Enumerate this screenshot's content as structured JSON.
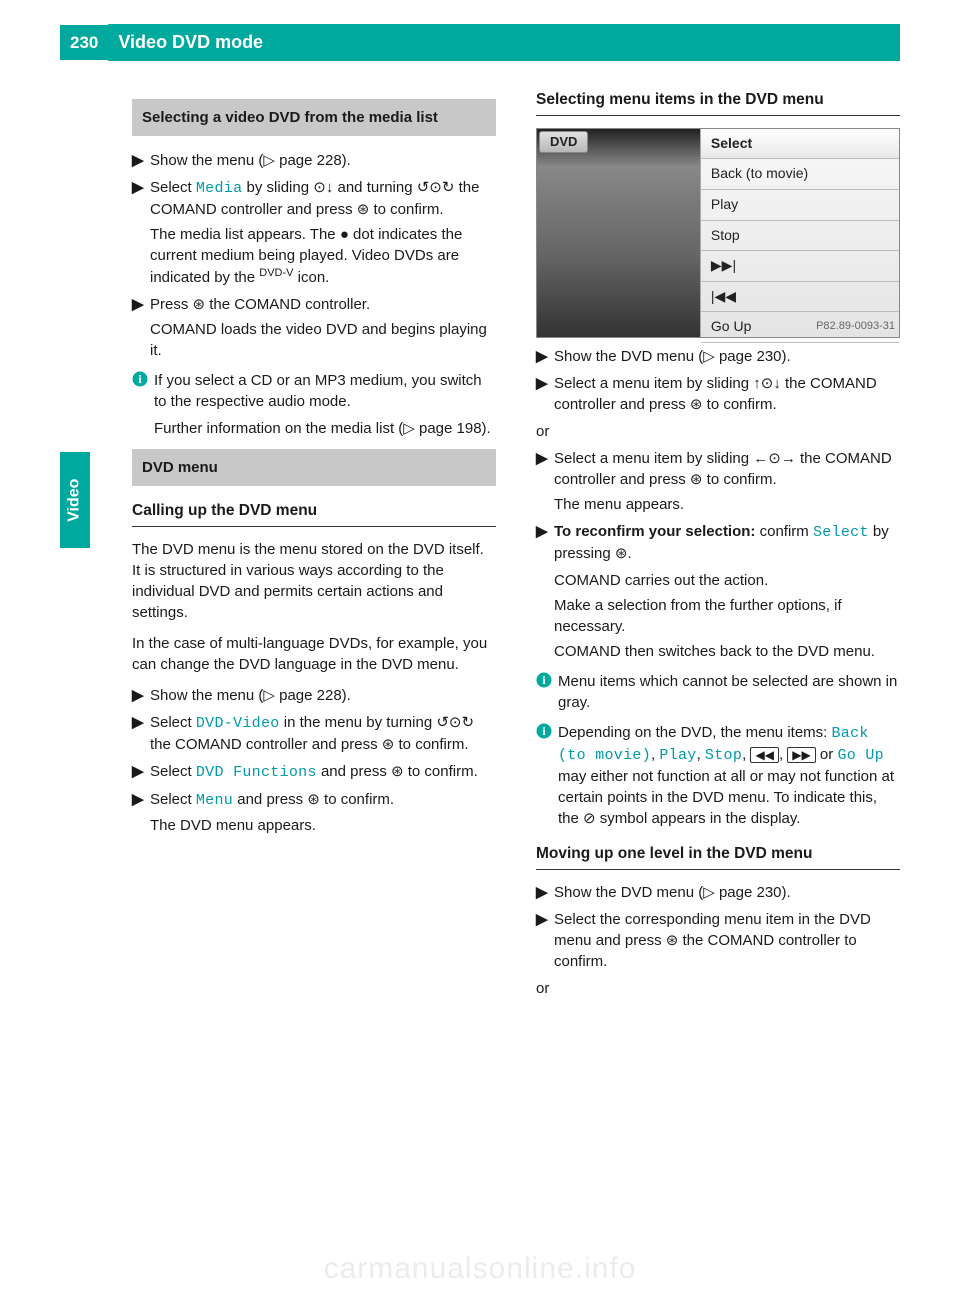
{
  "page_number": "230",
  "page_title": "Video DVD mode",
  "side_tab": "Video",
  "watermark": "carmanualsonline.info",
  "glyphs": {
    "step": "▶",
    "page_ref": "▷",
    "dot": "●",
    "press": "⊛",
    "info_title": "i",
    "slide_vert": "⊙↓",
    "turn": "↺⊙↻",
    "slide_ud": "↑⊙↓",
    "slide_lr": "←⊙→",
    "prohibit": "⊘",
    "dvd_icon": "ⓓ",
    "rewind": "◀◀",
    "ffwd": "▶▶"
  },
  "left": {
    "gray1": "Selecting a video DVD from the media list",
    "s1": {
      "pre": "Show the menu (",
      "suf": " page 228)."
    },
    "s2": {
      "pre": "Select ",
      "media": "Media",
      "mid1": " by sliding ",
      "mid2": " and turning ",
      "mid3": " the COMAND controller and press ",
      "suf": " to confirm."
    },
    "s2_cont": {
      "pre": "The media list appears. The ",
      "mid": " dot indicates the current medium being played. Video DVDs are indicated by the ",
      "suf": " icon."
    },
    "s3": {
      "pre": "Press ",
      "mid": " the COMAND controller.",
      "cont": "COMAND loads the video DVD and begins playing it."
    },
    "info1": {
      "l1": "If you select a CD or an MP3 medium, you switch to the respective audio mode.",
      "l2_pre": "Further information on the media list (",
      "l2_suf": " page 198)."
    },
    "gray2": "DVD menu",
    "sub1": "Calling up the DVD menu",
    "p1": "The DVD menu is the menu stored on the DVD itself. It is structured in various ways according to the individual DVD and permits certain actions and settings.",
    "p2": "In the case of multi-language DVDs, for example, you can change the DVD language in the DVD menu.",
    "s4": {
      "pre": "Show the menu (",
      "suf": " page 228)."
    },
    "s5": {
      "pre": "Select ",
      "dvdvideo": "DVD-Video",
      "mid1": " in the menu by turning ",
      "mid2": " the COMAND controller and press ",
      "suf": " to confirm."
    },
    "s6": {
      "pre": "Select ",
      "dvdfunc": "DVD Functions",
      "mid": " and press ",
      "suf": " to confirm."
    },
    "s7": {
      "pre": "Select ",
      "menu": "Menu",
      "mid": " and press ",
      "suf": " to confirm.",
      "cont": "The DVD menu appears."
    }
  },
  "right": {
    "sub1": "Selecting menu items in the DVD menu",
    "ss": {
      "tab": "DVD",
      "items": [
        "Select",
        "Back (to movie)",
        "Play",
        "Stop",
        "▶▶|",
        "|◀◀",
        "Go Up"
      ],
      "caption": "P82.89-0093-31"
    },
    "s1": {
      "pre": "Show the DVD menu (",
      "suf": " page 230)."
    },
    "s2": {
      "pre": "Select a menu item by sliding ",
      "mid": " the COMAND controller and press ",
      "suf": " to confirm."
    },
    "or": "or",
    "s3": {
      "pre": "Select a menu item by sliding ",
      "mid": " the COMAND controller and press ",
      "suf": " to confirm.",
      "cont": "The menu appears."
    },
    "s4": {
      "bold": "To reconfirm your selection:",
      "pre": " confirm ",
      "select": "Select",
      "mid": " by pressing ",
      "suf": "."
    },
    "indent1": "COMAND carries out the action.",
    "indent2": "Make a selection from the further options, if necessary.",
    "indent3": "COMAND then switches back to the DVD menu.",
    "info1": "Menu items which cannot be selected are shown in gray.",
    "info2": {
      "pre": "Depending on the DVD, the menu items: ",
      "back": "Back (to movie)",
      "play": "Play",
      "stop": "Stop",
      "goup": "Go Up",
      "mid": " may either not function at all or may not function at certain points in the DVD menu. To indicate this, the ",
      "suf": " symbol appears in the display."
    },
    "sub2": "Moving up one level in the DVD menu",
    "s5": {
      "pre": "Show the DVD menu (",
      "suf": " page 230)."
    },
    "s6": {
      "pre": "Select the corresponding menu item in the DVD menu and press ",
      "suf": " the COMAND controller to confirm."
    },
    "or2": "or"
  }
}
